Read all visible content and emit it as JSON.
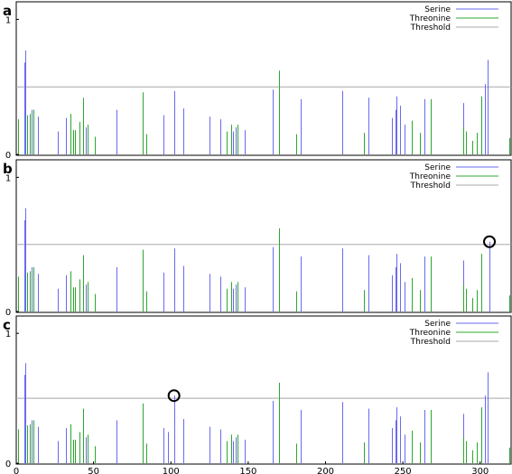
{
  "colors": {
    "serine": "#6a6af0",
    "threonine": "#2ca82c",
    "threshold": "#a8a8a8",
    "marker": "#000000"
  },
  "chart_data": [
    {
      "type": "bar",
      "panel_label": "a",
      "xlim": [
        0,
        320
      ],
      "ylim": [
        0,
        1.05
      ],
      "y_ticks": [
        "0",
        "1"
      ],
      "legend": {
        "placement": "top-right",
        "entries": [
          "Serine",
          "Threonine",
          "Threshold"
        ]
      },
      "threshold": 0.5,
      "series": [
        {
          "name": "Serine",
          "points": [
            [
              5,
              0.68
            ],
            [
              6,
              0.77
            ],
            [
              10,
              0.33
            ],
            [
              14,
              0.28
            ],
            [
              27,
              0.17
            ],
            [
              32,
              0.27
            ],
            [
              45,
              0.2
            ],
            [
              65,
              0.33
            ],
            [
              95,
              0.29
            ],
            [
              102,
              0.47
            ],
            [
              108,
              0.34
            ],
            [
              125,
              0.28
            ],
            [
              132,
              0.26
            ],
            [
              140,
              0.17
            ],
            [
              142,
              0.2
            ],
            [
              148,
              0.18
            ],
            [
              166,
              0.48
            ],
            [
              184,
              0.41
            ],
            [
              211,
              0.47
            ],
            [
              228,
              0.42
            ],
            [
              243,
              0.27
            ],
            [
              245,
              0.33
            ],
            [
              246,
              0.43
            ],
            [
              248,
              0.36
            ],
            [
              251,
              0.22
            ],
            [
              264,
              0.41
            ],
            [
              289,
              0.38
            ],
            [
              303,
              0.52
            ],
            [
              305,
              0.7
            ]
          ]
        },
        {
          "name": "Threonine",
          "points": [
            [
              1,
              0.26
            ],
            [
              7,
              0.29
            ],
            [
              9,
              0.3
            ],
            [
              11,
              0.33
            ],
            [
              35,
              0.3
            ],
            [
              37,
              0.18
            ],
            [
              38,
              0.18
            ],
            [
              41,
              0.24
            ],
            [
              43,
              0.42
            ],
            [
              46,
              0.22
            ],
            [
              51,
              0.13
            ],
            [
              82,
              0.46
            ],
            [
              84,
              0.15
            ],
            [
              136,
              0.17
            ],
            [
              139,
              0.22
            ],
            [
              143,
              0.22
            ],
            [
              170,
              0.62
            ],
            [
              181,
              0.15
            ],
            [
              225,
              0.16
            ],
            [
              256,
              0.25
            ],
            [
              261,
              0.16
            ],
            [
              268,
              0.41
            ],
            [
              289,
              0.2
            ],
            [
              291,
              0.17
            ],
            [
              295,
              0.1
            ],
            [
              298,
              0.16
            ],
            [
              301,
              0.43
            ],
            [
              319,
              0.12
            ]
          ]
        }
      ],
      "markers": []
    },
    {
      "type": "bar",
      "panel_label": "b",
      "xlim": [
        0,
        320
      ],
      "ylim": [
        0,
        1.05
      ],
      "y_ticks": [
        "0",
        "1"
      ],
      "legend": {
        "placement": "top-right",
        "entries": [
          "Serine",
          "Threonine",
          "Threshold"
        ]
      },
      "threshold": 0.5,
      "series": [
        {
          "name": "Serine",
          "points": [
            [
              5,
              0.68
            ],
            [
              6,
              0.77
            ],
            [
              10,
              0.33
            ],
            [
              14,
              0.28
            ],
            [
              27,
              0.17
            ],
            [
              32,
              0.27
            ],
            [
              45,
              0.2
            ],
            [
              65,
              0.33
            ],
            [
              95,
              0.29
            ],
            [
              102,
              0.47
            ],
            [
              108,
              0.34
            ],
            [
              125,
              0.28
            ],
            [
              132,
              0.26
            ],
            [
              140,
              0.17
            ],
            [
              142,
              0.2
            ],
            [
              148,
              0.18
            ],
            [
              166,
              0.48
            ],
            [
              184,
              0.41
            ],
            [
              211,
              0.47
            ],
            [
              228,
              0.42
            ],
            [
              243,
              0.27
            ],
            [
              245,
              0.33
            ],
            [
              246,
              0.43
            ],
            [
              248,
              0.36
            ],
            [
              251,
              0.22
            ],
            [
              264,
              0.41
            ],
            [
              289,
              0.38
            ],
            [
              306,
              0.52
            ]
          ]
        },
        {
          "name": "Threonine",
          "points": [
            [
              1,
              0.26
            ],
            [
              7,
              0.29
            ],
            [
              9,
              0.3
            ],
            [
              11,
              0.33
            ],
            [
              35,
              0.3
            ],
            [
              37,
              0.18
            ],
            [
              38,
              0.18
            ],
            [
              41,
              0.24
            ],
            [
              43,
              0.42
            ],
            [
              46,
              0.22
            ],
            [
              51,
              0.13
            ],
            [
              82,
              0.46
            ],
            [
              84,
              0.15
            ],
            [
              136,
              0.17
            ],
            [
              139,
              0.22
            ],
            [
              143,
              0.22
            ],
            [
              170,
              0.62
            ],
            [
              181,
              0.15
            ],
            [
              225,
              0.16
            ],
            [
              256,
              0.25
            ],
            [
              261,
              0.16
            ],
            [
              268,
              0.41
            ],
            [
              289,
              0.2
            ],
            [
              291,
              0.17
            ],
            [
              295,
              0.1
            ],
            [
              298,
              0.16
            ],
            [
              301,
              0.43
            ],
            [
              319,
              0.12
            ]
          ]
        }
      ],
      "markers": [
        [
          306,
          0.52
        ]
      ]
    },
    {
      "type": "bar",
      "panel_label": "c",
      "xlim": [
        0,
        320
      ],
      "ylim": [
        0,
        1.05
      ],
      "y_ticks": [
        "0",
        "1"
      ],
      "x_ticks": [
        "0",
        "50",
        "100",
        "150",
        "200",
        "250",
        "300"
      ],
      "legend": {
        "placement": "top-right",
        "entries": [
          "Serine",
          "Threonine",
          "Threshold"
        ]
      },
      "threshold": 0.5,
      "series": [
        {
          "name": "Serine",
          "points": [
            [
              5,
              0.68
            ],
            [
              6,
              0.77
            ],
            [
              10,
              0.33
            ],
            [
              14,
              0.28
            ],
            [
              27,
              0.17
            ],
            [
              32,
              0.27
            ],
            [
              45,
              0.2
            ],
            [
              65,
              0.33
            ],
            [
              95,
              0.27
            ],
            [
              98,
              0.24
            ],
            [
              102,
              0.52
            ],
            [
              108,
              0.34
            ],
            [
              125,
              0.28
            ],
            [
              132,
              0.26
            ],
            [
              140,
              0.17
            ],
            [
              142,
              0.2
            ],
            [
              148,
              0.18
            ],
            [
              166,
              0.48
            ],
            [
              184,
              0.41
            ],
            [
              211,
              0.47
            ],
            [
              228,
              0.42
            ],
            [
              243,
              0.27
            ],
            [
              245,
              0.33
            ],
            [
              246,
              0.43
            ],
            [
              248,
              0.36
            ],
            [
              251,
              0.22
            ],
            [
              264,
              0.41
            ],
            [
              289,
              0.38
            ],
            [
              303,
              0.52
            ],
            [
              305,
              0.7
            ]
          ]
        },
        {
          "name": "Threonine",
          "points": [
            [
              1,
              0.26
            ],
            [
              7,
              0.29
            ],
            [
              9,
              0.3
            ],
            [
              11,
              0.33
            ],
            [
              35,
              0.3
            ],
            [
              37,
              0.18
            ],
            [
              38,
              0.18
            ],
            [
              41,
              0.24
            ],
            [
              43,
              0.42
            ],
            [
              46,
              0.22
            ],
            [
              51,
              0.13
            ],
            [
              82,
              0.46
            ],
            [
              84,
              0.15
            ],
            [
              136,
              0.17
            ],
            [
              139,
              0.22
            ],
            [
              143,
              0.22
            ],
            [
              170,
              0.62
            ],
            [
              181,
              0.15
            ],
            [
              225,
              0.16
            ],
            [
              256,
              0.25
            ],
            [
              261,
              0.16
            ],
            [
              268,
              0.41
            ],
            [
              289,
              0.2
            ],
            [
              291,
              0.17
            ],
            [
              295,
              0.1
            ],
            [
              298,
              0.16
            ],
            [
              301,
              0.43
            ],
            [
              319,
              0.12
            ]
          ]
        }
      ],
      "markers": [
        [
          102,
          0.52
        ]
      ]
    }
  ]
}
